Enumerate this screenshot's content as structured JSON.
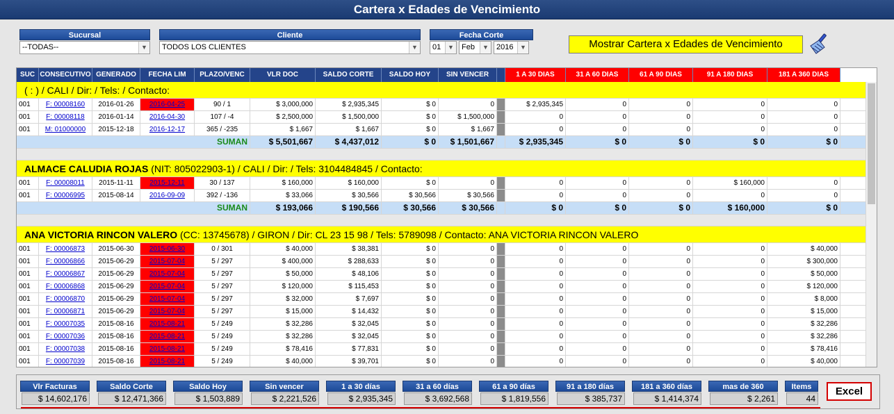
{
  "title": "Cartera x Edades de Vencimiento",
  "filters": {
    "sucursal_label": "Sucursal",
    "sucursal_value": "--TODAS--",
    "cliente_label": "Cliente",
    "cliente_value": "TODOS LOS CLIENTES",
    "fecha_label": "Fecha Corte",
    "fecha_day": "01",
    "fecha_month": "Feb",
    "fecha_year": "2016"
  },
  "show_button": "Mostrar Cartera x Edades de Vencimiento",
  "columns": [
    "SUC",
    "CONSECUTIVO",
    "GENERADO",
    "FECHA LIM",
    "PLAZO/VENC",
    "VLR DOC",
    "SALDO CORTE",
    "SALDO HOY",
    "SIN VENCER",
    "",
    "1 A 30 DIAS",
    "31 A 60 DIAS",
    "61 A 90 DIAS",
    "91 A 180 DIAS",
    "181 A 360 DIAS"
  ],
  "groups": [
    {
      "client_name": "",
      "client_info": "( : ) / CALI / Dir: / Tels: / Contacto:",
      "rows": [
        {
          "suc": "001",
          "cons": "F: 00008160",
          "gen": "2016-01-26",
          "lim": "2016-04-25",
          "lim_red": true,
          "plazo": "90 / 1",
          "vlr": "$ 3,000,000",
          "saldo": "$ 2,935,345",
          "hoy": "$ 0",
          "sinv": "0",
          "d1": "$ 2,935,345",
          "d2": "0",
          "d3": "0",
          "d4": "0",
          "d5": "0"
        },
        {
          "suc": "001",
          "cons": "F: 00008118",
          "gen": "2016-01-14",
          "lim": "2016-04-30",
          "lim_red": false,
          "plazo": "107 / -4",
          "vlr": "$ 2,500,000",
          "saldo": "$ 1,500,000",
          "hoy": "$ 0",
          "sinv": "$ 1,500,000",
          "d1": "0",
          "d2": "0",
          "d3": "0",
          "d4": "0",
          "d5": "0"
        },
        {
          "suc": "001",
          "cons": "M: 01000000",
          "gen": "2015-12-18",
          "lim": "2016-12-17",
          "lim_red": false,
          "plazo": "365 / -235",
          "vlr": "$ 1,667",
          "saldo": "$ 1,667",
          "hoy": "$ 0",
          "sinv": "$ 1,667",
          "d1": "0",
          "d2": "0",
          "d3": "0",
          "d4": "0",
          "d5": "0"
        }
      ],
      "sum": {
        "label": "SUMAN",
        "vlr": "$ 5,501,667",
        "saldo": "$ 4,437,012",
        "hoy": "$ 0",
        "sinv": "$ 1,501,667",
        "d1": "$ 2,935,345",
        "d2": "$ 0",
        "d3": "$ 0",
        "d4": "$ 0",
        "d5": "$ 0"
      }
    },
    {
      "client_name": "ALMACE CALUDIA ROJAS",
      "client_info": " (NIT: 805022903-1) / CALI / Dir: / Tels: 3104484845 / Contacto:",
      "rows": [
        {
          "suc": "001",
          "cons": "F: 00008011",
          "gen": "2015-11-11",
          "lim": "2015-12-11",
          "lim_red": true,
          "plazo": "30 / 137",
          "vlr": "$ 160,000",
          "saldo": "$ 160,000",
          "hoy": "$ 0",
          "sinv": "0",
          "d1": "0",
          "d2": "0",
          "d3": "0",
          "d4": "$ 160,000",
          "d5": "0"
        },
        {
          "suc": "001",
          "cons": "F: 00006995",
          "gen": "2015-08-14",
          "lim": "2016-09-09",
          "lim_red": false,
          "plazo": "392 / -136",
          "vlr": "$ 33,066",
          "saldo": "$ 30,566",
          "hoy": "$ 30,566",
          "sinv": "$ 30,566",
          "d1": "0",
          "d2": "0",
          "d3": "0",
          "d4": "0",
          "d5": "0"
        }
      ],
      "sum": {
        "label": "SUMAN",
        "vlr": "$ 193,066",
        "saldo": "$ 190,566",
        "hoy": "$ 30,566",
        "sinv": "$ 30,566",
        "d1": "$ 0",
        "d2": "$ 0",
        "d3": "$ 0",
        "d4": "$ 160,000",
        "d5": "$ 0"
      }
    },
    {
      "client_name": "ANA VICTORIA RINCON VALERO",
      "client_info": " (CC: 13745678) / GIRON / Dir: CL 23 15 98 / Tels: 5789098 / Contacto: ANA VICTORIA RINCON VALERO",
      "rows": [
        {
          "suc": "001",
          "cons": "F: 00006873",
          "gen": "2015-06-30",
          "lim": "2015-06-30",
          "lim_red": true,
          "plazo": "0 / 301",
          "vlr": "$ 40,000",
          "saldo": "$ 38,381",
          "hoy": "$ 0",
          "sinv": "0",
          "d1": "0",
          "d2": "0",
          "d3": "0",
          "d4": "0",
          "d5": "$ 40,000"
        },
        {
          "suc": "001",
          "cons": "F: 00006866",
          "gen": "2015-06-29",
          "lim": "2015-07-04",
          "lim_red": true,
          "plazo": "5 / 297",
          "vlr": "$ 400,000",
          "saldo": "$ 288,633",
          "hoy": "$ 0",
          "sinv": "0",
          "d1": "0",
          "d2": "0",
          "d3": "0",
          "d4": "0",
          "d5": "$ 300,000"
        },
        {
          "suc": "001",
          "cons": "F: 00006867",
          "gen": "2015-06-29",
          "lim": "2015-07-04",
          "lim_red": true,
          "plazo": "5 / 297",
          "vlr": "$ 50,000",
          "saldo": "$ 48,106",
          "hoy": "$ 0",
          "sinv": "0",
          "d1": "0",
          "d2": "0",
          "d3": "0",
          "d4": "0",
          "d5": "$ 50,000"
        },
        {
          "suc": "001",
          "cons": "F: 00006868",
          "gen": "2015-06-29",
          "lim": "2015-07-04",
          "lim_red": true,
          "plazo": "5 / 297",
          "vlr": "$ 120,000",
          "saldo": "$ 115,453",
          "hoy": "$ 0",
          "sinv": "0",
          "d1": "0",
          "d2": "0",
          "d3": "0",
          "d4": "0",
          "d5": "$ 120,000"
        },
        {
          "suc": "001",
          "cons": "F: 00006870",
          "gen": "2015-06-29",
          "lim": "2015-07-04",
          "lim_red": true,
          "plazo": "5 / 297",
          "vlr": "$ 32,000",
          "saldo": "$ 7,697",
          "hoy": "$ 0",
          "sinv": "0",
          "d1": "0",
          "d2": "0",
          "d3": "0",
          "d4": "0",
          "d5": "$ 8,000"
        },
        {
          "suc": "001",
          "cons": "F: 00006871",
          "gen": "2015-06-29",
          "lim": "2015-07-04",
          "lim_red": true,
          "plazo": "5 / 297",
          "vlr": "$ 15,000",
          "saldo": "$ 14,432",
          "hoy": "$ 0",
          "sinv": "0",
          "d1": "0",
          "d2": "0",
          "d3": "0",
          "d4": "0",
          "d5": "$ 15,000"
        },
        {
          "suc": "001",
          "cons": "F: 00007035",
          "gen": "2015-08-16",
          "lim": "2015-08-21",
          "lim_red": true,
          "plazo": "5 / 249",
          "vlr": "$ 32,286",
          "saldo": "$ 32,045",
          "hoy": "$ 0",
          "sinv": "0",
          "d1": "0",
          "d2": "0",
          "d3": "0",
          "d4": "0",
          "d5": "$ 32,286"
        },
        {
          "suc": "001",
          "cons": "F: 00007036",
          "gen": "2015-08-16",
          "lim": "2015-08-21",
          "lim_red": true,
          "plazo": "5 / 249",
          "vlr": "$ 32,286",
          "saldo": "$ 32,045",
          "hoy": "$ 0",
          "sinv": "0",
          "d1": "0",
          "d2": "0",
          "d3": "0",
          "d4": "0",
          "d5": "$ 32,286"
        },
        {
          "suc": "001",
          "cons": "F: 00007038",
          "gen": "2015-08-16",
          "lim": "2015-08-21",
          "lim_red": true,
          "plazo": "5 / 249",
          "vlr": "$ 78,416",
          "saldo": "$ 77,831",
          "hoy": "$ 0",
          "sinv": "0",
          "d1": "0",
          "d2": "0",
          "d3": "0",
          "d4": "0",
          "d5": "$ 78,416"
        },
        {
          "suc": "001",
          "cons": "F: 00007039",
          "gen": "2015-08-16",
          "lim": "2015-08-21",
          "lim_red": true,
          "plazo": "5 / 249",
          "vlr": "$ 40,000",
          "saldo": "$ 39,701",
          "hoy": "$ 0",
          "sinv": "0",
          "d1": "0",
          "d2": "0",
          "d3": "0",
          "d4": "0",
          "d5": "$ 40,000"
        }
      ]
    }
  ],
  "totals": [
    {
      "label": "Vlr Facturas",
      "value": "$ 14,602,176"
    },
    {
      "label": "Saldo Corte",
      "value": "$ 12,471,366"
    },
    {
      "label": "Saldo Hoy",
      "value": "$ 1,503,889"
    },
    {
      "label": "Sin vencer",
      "value": "$ 2,221,526"
    },
    {
      "label": "1 a 30 días",
      "value": "$ 2,935,345"
    },
    {
      "label": "31 a 60 días",
      "value": "$ 3,692,568"
    },
    {
      "label": "61 a 90 días",
      "value": "$ 1,819,556"
    },
    {
      "label": "91 a 180 días",
      "value": "$ 385,737"
    },
    {
      "label": "181 a 360 días",
      "value": "$ 1,414,374"
    },
    {
      "label": "mas de 360",
      "value": "$ 2,261"
    },
    {
      "label": "Items",
      "value": "44"
    }
  ],
  "excel_label": "Excel",
  "colors": {
    "header_blue": "#24448a",
    "client_yellow": "#ffff00",
    "overdue_red": "#ff0000",
    "sum_blue": "#c6def7",
    "sum_green": "#1a8a1a"
  },
  "icons": [
    "chevron-down-icon",
    "broom-icon"
  ]
}
